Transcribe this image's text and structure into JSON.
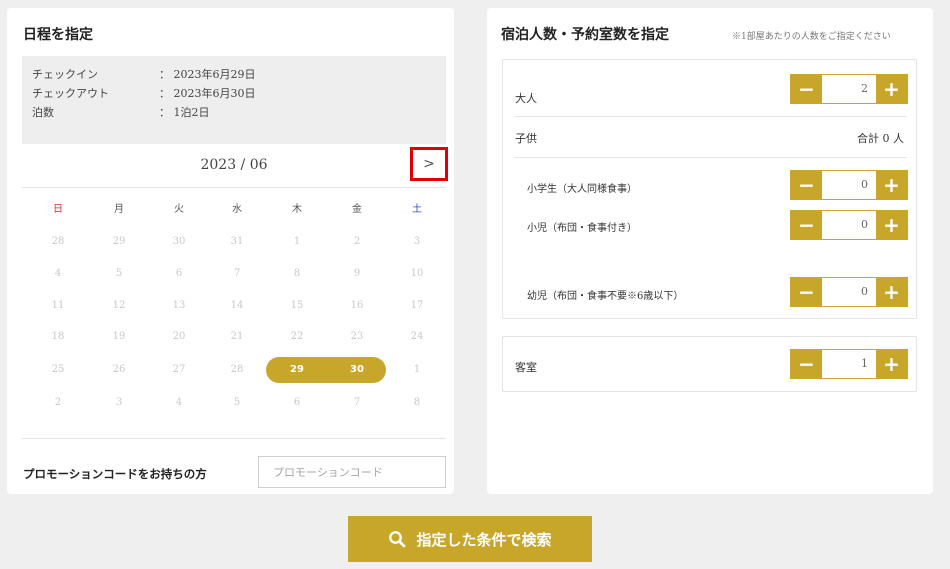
{
  "schedule": {
    "title": "日程を指定",
    "checkin_label": "チェックイン",
    "checkin_value": "： 2023年6月29日",
    "checkout_label": "チェックアウト",
    "checkout_value": "： 2023年6月30日",
    "nights_label": "泊数",
    "nights_value": "： 1泊2日"
  },
  "calendar": {
    "month_label": "2023 / 06",
    "next_label": ">",
    "weekdays": [
      "日",
      "月",
      "火",
      "水",
      "木",
      "金",
      "土"
    ],
    "weeks": [
      [
        "28",
        "29",
        "30",
        "31",
        "1",
        "2",
        "3"
      ],
      [
        "4",
        "5",
        "6",
        "7",
        "8",
        "9",
        "10"
      ],
      [
        "11",
        "12",
        "13",
        "14",
        "15",
        "16",
        "17"
      ],
      [
        "18",
        "19",
        "20",
        "21",
        "22",
        "23",
        "24"
      ],
      [
        "25",
        "26",
        "27",
        "28",
        "29",
        "30",
        "1"
      ],
      [
        "2",
        "3",
        "4",
        "5",
        "6",
        "7",
        "8"
      ]
    ],
    "selected": [
      "29",
      "30"
    ]
  },
  "promo": {
    "label": "プロモーションコードをお持ちの方",
    "placeholder": "プロモーションコード"
  },
  "guests": {
    "title": "宿泊人数・予約室数を指定",
    "note": "※1部屋あたりの人数をご指定ください",
    "adult_label": "大人",
    "adult_value": "2",
    "child_label": "子供",
    "child_total": "合計 0 人",
    "elementary_label": "小学生（大人同様食事）",
    "elementary_value": "0",
    "kid_label": "小児（布団・食事付き）",
    "kid_value": "0",
    "infant_label": "幼児（布団・食事不要※6歳以下）",
    "infant_value": "0",
    "room_label": "客室",
    "room_value": "1"
  },
  "search": {
    "label": "指定した条件で検索"
  },
  "colors": {
    "accent": "#c8a62a",
    "highlight_border": "#e00000",
    "sunday": "#d03030",
    "saturday": "#3050c0"
  }
}
